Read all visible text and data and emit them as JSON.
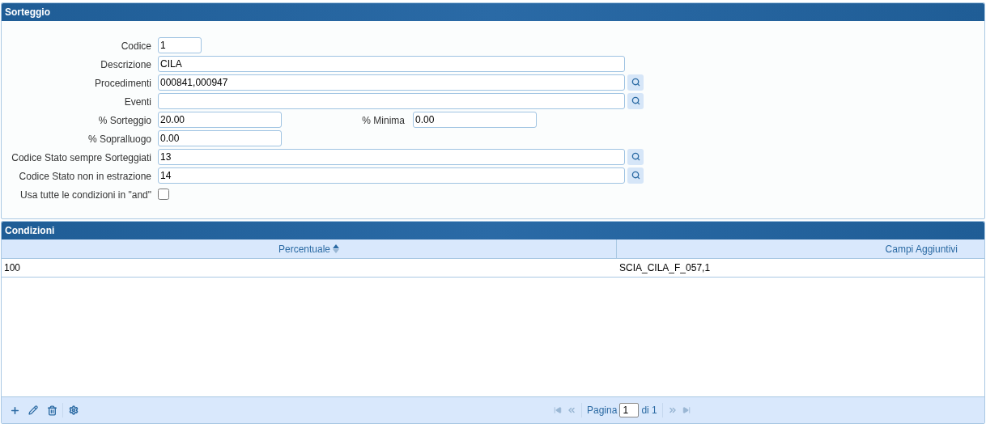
{
  "panel": {
    "title": "Sorteggio"
  },
  "fields": [
    {
      "label": "Codice",
      "value": "1",
      "kind": "short",
      "lookup": false
    },
    {
      "label": "Descrizione",
      "value": "CILA",
      "kind": "long",
      "lookup": false
    },
    {
      "label": "Procedimenti",
      "value": "000841,000947",
      "kind": "long",
      "lookup": true
    },
    {
      "label": "Eventi",
      "kind": "long",
      "lookup": true
    },
    {
      "label": "% Sorteggio",
      "value": "20.00",
      "kind": "medium",
      "lookup": false,
      "extra": {
        "label": "% Minima",
        "value": "0.00"
      }
    },
    {
      "label": "% Sopralluogo",
      "value": "0.00",
      "kind": "medium",
      "lookup": false
    },
    {
      "label": "Codice Stato sempre Sorteggiati",
      "value": "13",
      "kind": "long",
      "lookup": true
    },
    {
      "label": "Codice Stato non in estrazione",
      "value": "14",
      "kind": "long",
      "lookup": true
    },
    {
      "label": "Usa tutte le condizioni in \"and\"",
      "kind": "checkbox",
      "checked": false
    }
  ],
  "grid": {
    "title": "Condizioni",
    "columns": [
      {
        "label": "Percentuale",
        "sorted": true
      },
      {
        "label": "Campi Aggiuntivi",
        "sorted": false
      }
    ],
    "rows": [
      [
        "100",
        "SCIA_CILA_F_057,1"
      ]
    ],
    "pager": {
      "label": "Pagina",
      "page": "1",
      "total": "di 1"
    }
  }
}
